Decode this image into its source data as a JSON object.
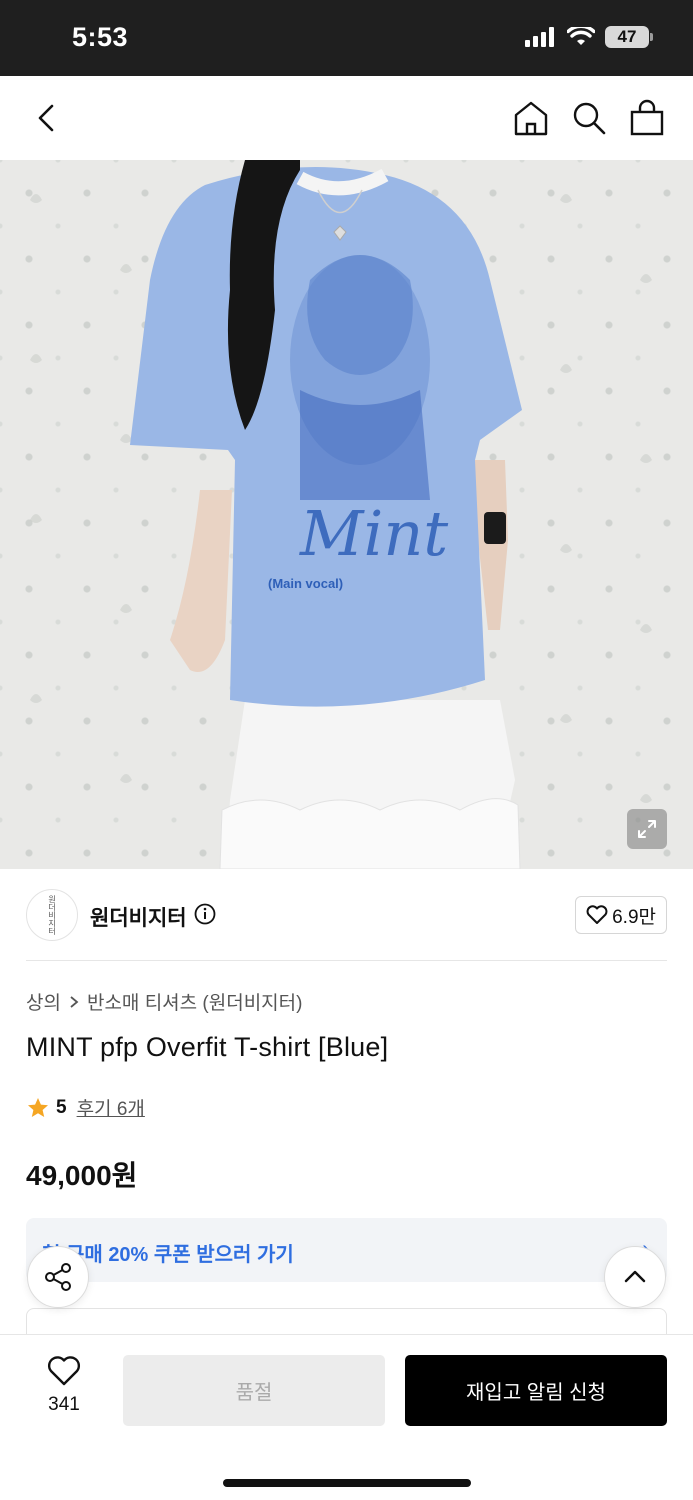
{
  "status_bar": {
    "time": "5:53",
    "battery": "47"
  },
  "nav": {
    "icons": [
      "chevron-left-icon",
      "home-icon",
      "search-icon",
      "shopping-bag-icon"
    ]
  },
  "hero": {
    "description_icon": "expand-icon",
    "colors": {
      "shirt": "#9ab7e6",
      "shirt_dark": "#7f9fd6",
      "print": "#2e5fb8",
      "skirt": "#f4f4f4",
      "hair": "#151515"
    },
    "print_text": {
      "script": "Mint",
      "sub": "(Main vocal)"
    }
  },
  "brand": {
    "logo_text": "원더비지터",
    "name": "원더비지터",
    "like_count": "6.9만"
  },
  "product": {
    "breadcrumb_category": "상의",
    "breadcrumb_sub": "반소매 티셔츠 (원더비지터)",
    "title": "MINT pfp Overfit T-shirt [Blue]",
    "rating": "5",
    "reviews": "후기 6개",
    "price": "49,000원"
  },
  "coupon": {
    "text": "첫 구매 20% 쿠폰 받으러 가기",
    "arrow": "›"
  },
  "bottom": {
    "like_count": "341",
    "soldout_label": "품절",
    "restock_label": "재입고 알림 신청"
  },
  "colors": {
    "accent_blue": "#2f6ee0",
    "star": "#f5a623",
    "primary_black": "#000000"
  }
}
